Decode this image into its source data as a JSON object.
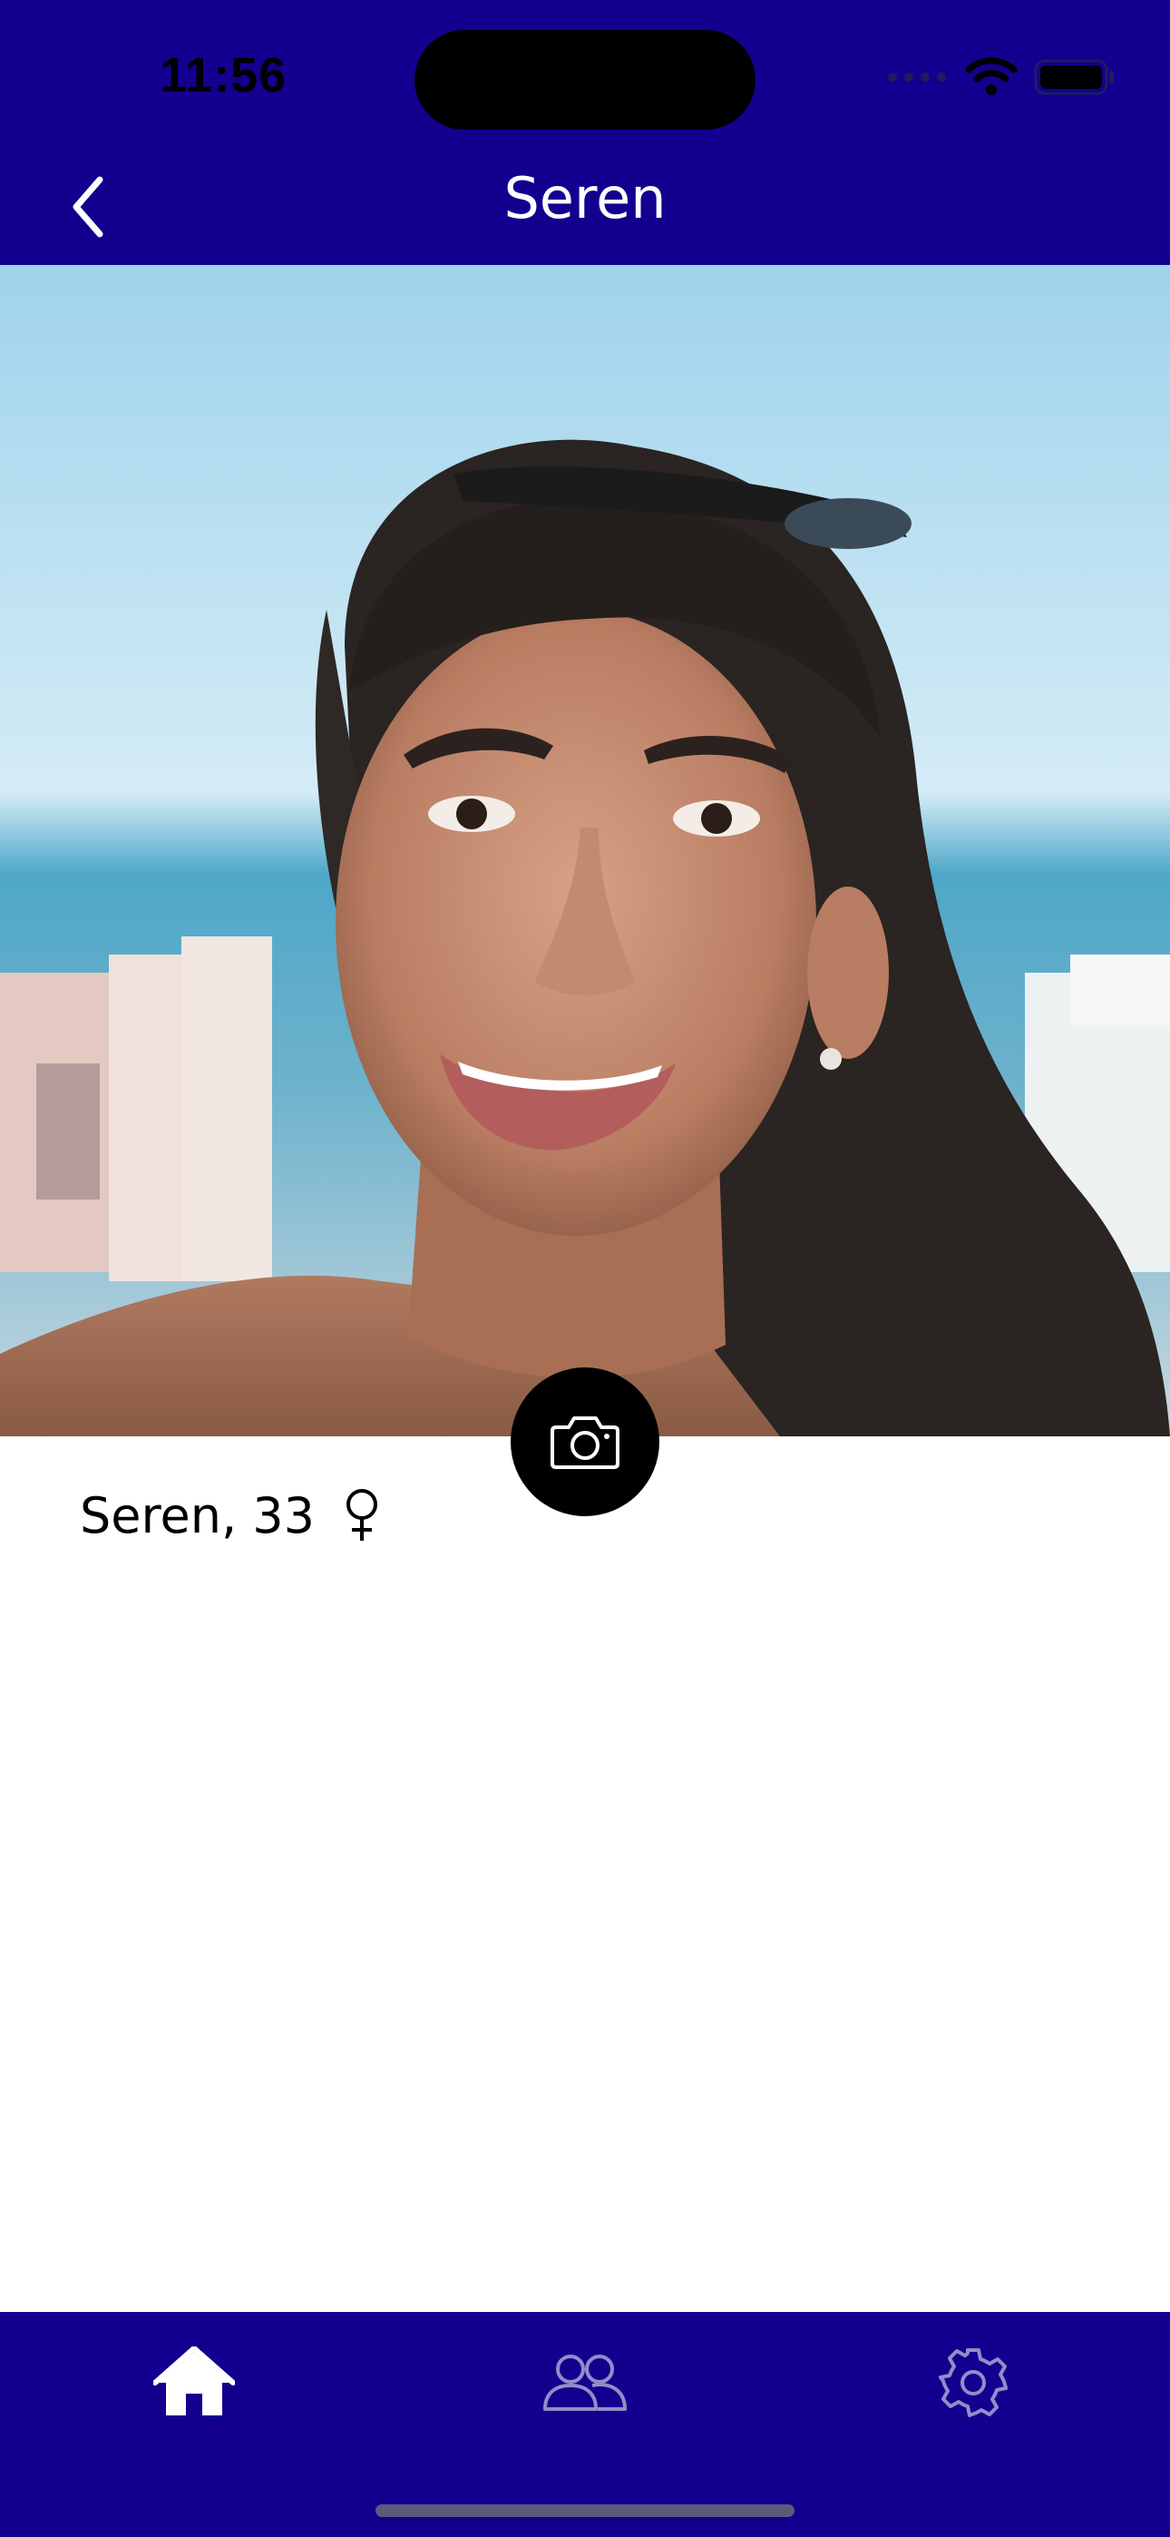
{
  "status_bar": {
    "time": "11:56"
  },
  "nav": {
    "title": "Seren",
    "back_icon": "chevron-left-icon"
  },
  "profile": {
    "name_age": "Seren, 33",
    "gender_icon": "female-symbol-icon",
    "photo_description_icon": "profile-photo",
    "camera_icon": "camera-icon"
  },
  "tabs": [
    {
      "icon": "home-icon",
      "active": true
    },
    {
      "icon": "people-icon",
      "active": false
    },
    {
      "icon": "gear-icon",
      "active": false
    }
  ],
  "colors": {
    "brand": "#14008f",
    "active_tab": "#ffffff",
    "inactive_tab": "#8f8fc8"
  }
}
